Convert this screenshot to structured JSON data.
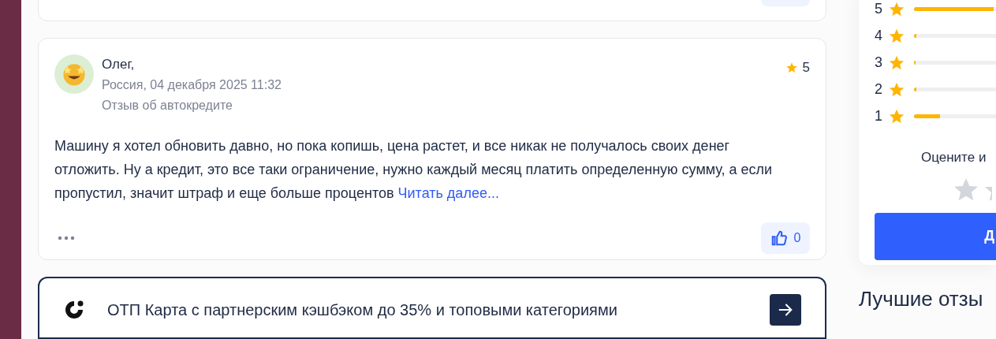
{
  "review": {
    "author": "Олег,",
    "meta": "Россия, 04 декабря 2025 11:32",
    "topic": "Отзыв об автокредите",
    "rating": "5",
    "text": "Машину я хотел обновить давно, но пока копишь, цена растет, и все никак не получалось своих денег отложить. Ну а кредит, это все таки ограничение, нужно каждый месяц платить определенную сумму, а если пропустил, значит штраф и еще больше процентов",
    "read_more": "Читать далее...",
    "likes": "0"
  },
  "promo": {
    "title": "ОТП Карта с партнерским кэшбэком до 35% и топовыми категориями"
  },
  "rating_breakdown": [
    {
      "label": "5",
      "level": 0.97
    },
    {
      "label": "4",
      "level": 0.03
    },
    {
      "label": "3",
      "level": 0.02
    },
    {
      "label": "2",
      "level": 0.03
    },
    {
      "label": "1",
      "level": 0.32
    }
  ],
  "rate_prompt": "Оцените и",
  "submit_button": "Д",
  "best_reviews_heading": "Лучшие отзы"
}
